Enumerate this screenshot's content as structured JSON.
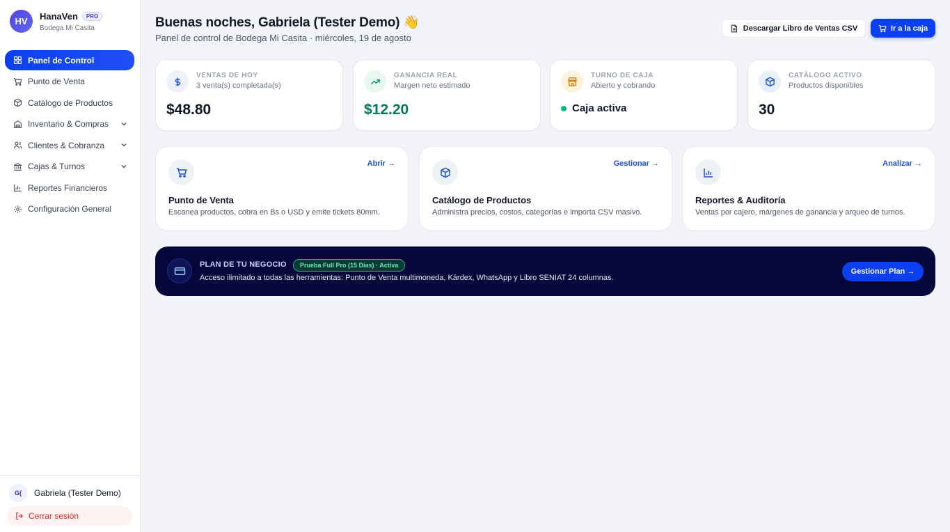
{
  "brand": {
    "logo": "HV",
    "name": "HanaVen",
    "badge": "PRO",
    "store": "Bodega Mi Casita"
  },
  "sidebar": {
    "items": [
      {
        "label": "Panel de Control",
        "icon": "grid-icon",
        "active": true
      },
      {
        "label": "Punto de Venta",
        "icon": "cart-icon"
      },
      {
        "label": "Catálogo de Productos",
        "icon": "box-icon"
      },
      {
        "label": "Inventario & Compras",
        "icon": "warehouse-icon",
        "expandable": true
      },
      {
        "label": "Clientes & Cobranza",
        "icon": "users-icon",
        "expandable": true
      },
      {
        "label": "Cajas & Turnos",
        "icon": "bank-icon",
        "expandable": true
      },
      {
        "label": "Reportes Financieros",
        "icon": "bar-chart-icon"
      },
      {
        "label": "Configuración General",
        "icon": "gear-icon"
      }
    ],
    "user": {
      "initials": "G(",
      "name": "Gabriela (Tester Demo)"
    },
    "logout_label": "Cerrar sesión"
  },
  "header": {
    "greeting": "Buenas noches, Gabriela (Tester Demo) 👋",
    "subtitle": "Panel de control de Bodega Mi Casita · miércoles, 19 de agosto",
    "csv_button": "Descargar Libro de Ventas CSV",
    "caja_button": "Ir a la caja"
  },
  "stats": [
    {
      "label": "VENTAS DE HOY",
      "sub": "3 venta(s) completada(s)",
      "value": "$48.80",
      "icon": "dollar-icon"
    },
    {
      "label": "GANANCIA REAL",
      "sub": "Margen neto estimado",
      "value": "$12.20",
      "icon": "trend-up-icon"
    },
    {
      "label": "TURNO DE CAJA",
      "sub": "Abierto y cobrando",
      "value": "Caja activa",
      "icon": "store-icon"
    },
    {
      "label": "CATÁLOGO ACTIVO",
      "sub": "Productos disponibles",
      "value": "30",
      "icon": "box-icon"
    }
  ],
  "modules": [
    {
      "title": "Punto de Venta",
      "desc": "Escanea productos, cobra en Bs o USD y emite tickets 80mm.",
      "link": "Abrir →",
      "icon": "cart-icon"
    },
    {
      "title": "Catálogo de Productos",
      "desc": "Administra precios, costos, categorías e importa CSV masivo.",
      "link": "Gestionar →",
      "icon": "box-icon"
    },
    {
      "title": "Reportes & Auditoría",
      "desc": "Ventas por cajero, márgenes de ganancia y arqueo de turnos.",
      "link": "Analizar →",
      "icon": "bar-chart-icon"
    }
  ],
  "plan": {
    "title": "PLAN DE TU NEGOCIO",
    "badge": "Prueba Full Pro (15 Días) · Activa",
    "desc": "Acceso ilimitado a todas las herramientas: Punto de Venta multimoneda, Kárdex, WhatsApp y Libro SENIAT 24 columnas.",
    "button": "Gestionar Plan →"
  },
  "colors": {
    "accent": "#0b3ff0",
    "banner": "#06073b",
    "success": "#10b981",
    "danger": "#dc2626"
  }
}
